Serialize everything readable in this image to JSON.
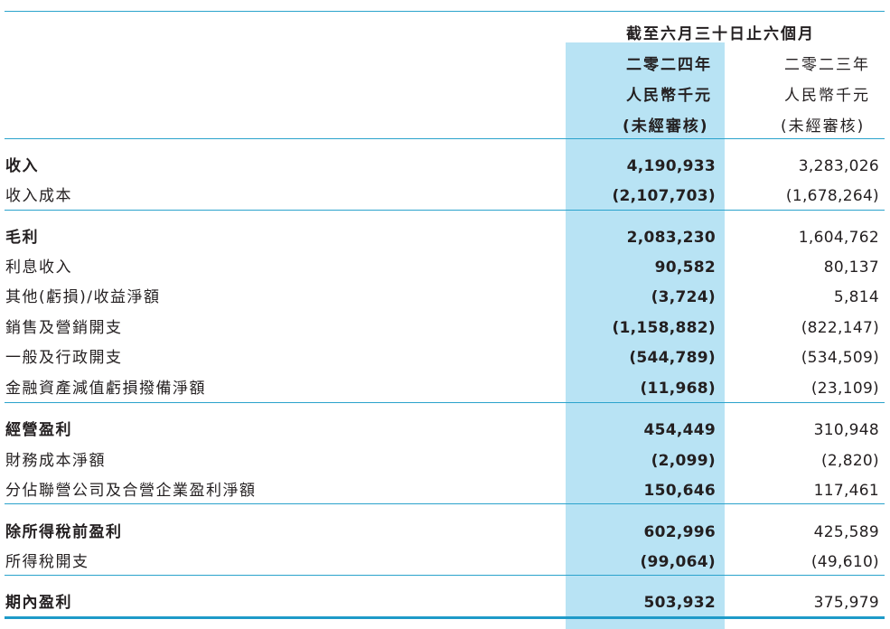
{
  "header": {
    "period": "截至六月三十日止六個月",
    "col_2024": {
      "year": "二零二四年",
      "unit": "人民幣千元",
      "audit": "(未經審核)"
    },
    "col_2023": {
      "year": "二零二三年",
      "unit": "人民幣千元",
      "audit": "(未經審核)"
    }
  },
  "colors": {
    "highlight": "#b8e3f4",
    "rule": "#2ba3cc"
  },
  "rows": [
    {
      "label": "收入",
      "v2024": "4,190,933",
      "v2023": "3,283,026"
    },
    {
      "label": "收入成本",
      "v2024": "(2,107,703)",
      "v2023": "(1,678,264)"
    },
    {
      "label": "毛利",
      "v2024": "2,083,230",
      "v2023": "1,604,762"
    },
    {
      "label": "利息收入",
      "v2024": "90,582",
      "v2023": "80,137"
    },
    {
      "label": "其他(虧損)/收益淨額",
      "v2024": "(3,724)",
      "v2023": "5,814"
    },
    {
      "label": "銷售及營銷開支",
      "v2024": "(1,158,882)",
      "v2023": "(822,147)"
    },
    {
      "label": "一般及行政開支",
      "v2024": "(544,789)",
      "v2023": "(534,509)"
    },
    {
      "label": "金融資產減值虧損撥備淨額",
      "v2024": "(11,968)",
      "v2023": "(23,109)"
    },
    {
      "label": "經營盈利",
      "v2024": "454,449",
      "v2023": "310,948"
    },
    {
      "label": "財務成本淨額",
      "v2024": "(2,099)",
      "v2023": "(2,820)"
    },
    {
      "label": "分佔聯營公司及合營企業盈利淨額",
      "v2024": "150,646",
      "v2023": "117,461"
    },
    {
      "label": "除所得稅前盈利",
      "v2024": "602,996",
      "v2023": "425,589"
    },
    {
      "label": "所得稅開支",
      "v2024": "(99,064)",
      "v2023": "(49,610)"
    },
    {
      "label": "期內盈利",
      "v2024": "503,932",
      "v2023": "375,979"
    }
  ]
}
